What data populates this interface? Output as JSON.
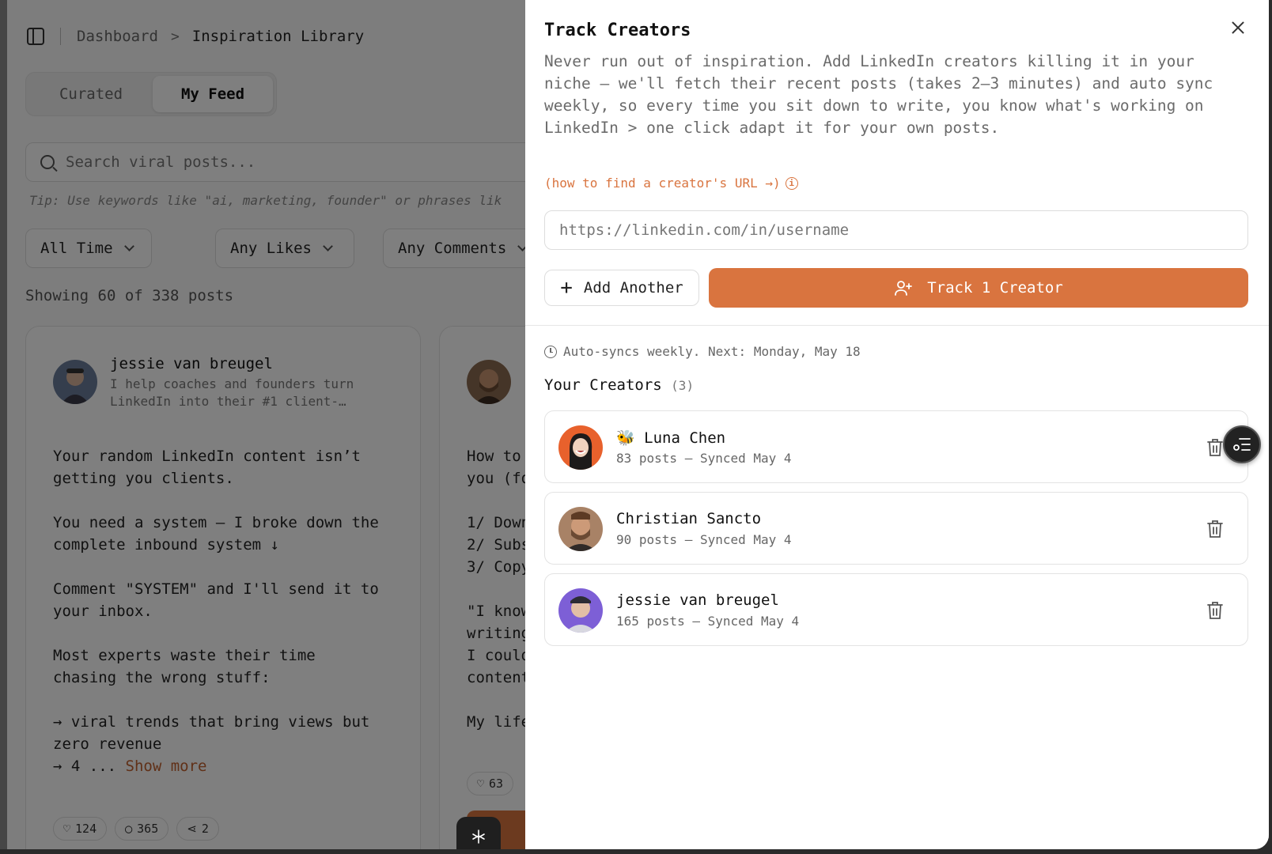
{
  "background": {
    "breadcrumb": {
      "root": "Dashboard",
      "separator": ">",
      "current": "Inspiration Library"
    },
    "tabs": [
      {
        "label": "Curated"
      },
      {
        "label": "My Feed"
      }
    ],
    "search": {
      "placeholder": "Search viral posts..."
    },
    "tip": "Tip: Use keywords like \"ai, marketing, founder\" or phrases lik",
    "filters": [
      {
        "label": "All Time"
      },
      {
        "label": "Any Likes"
      },
      {
        "label": "Any Comments"
      }
    ],
    "showing": "Showing 60 of 338 posts",
    "cards": [
      {
        "author": "jessie van breugel",
        "subtitle": "I help coaches and founders turn LinkedIn into their #1 client-…",
        "body": "Your random LinkedIn content isn’t\ngetting you clients.\n\nYou need a system — I broke down the\ncomplete inbound system ↓\n\nComment \"SYSTEM\" and I'll send it to\nyour inbox.\n\nMost experts waste their time\nchasing the wrong stuff:\n\n→ viral trends that bring views but\nzero revenue\n→ 4 ...",
        "show_more": "Show more",
        "likes": "124",
        "comments": "365",
        "shares": "2"
      },
      {
        "body": "How to\nyou (fo\n\n1/ Down\n2/ Subs\n3/ Copy\n\n\"I know\nwriting\nI could\ncontent\n\nMy life",
        "likes": "63"
      }
    ]
  },
  "drawer": {
    "title": "Track Creators",
    "description": "Never run out of inspiration. Add LinkedIn creators killing it in your niche — we'll fetch their recent posts (takes 2–3 minutes) and auto sync weekly, so every time you sit down to write, you know what's working on LinkedIn > one click adapt it for your own posts.",
    "howto_link": "(how to find a creator's URL →)",
    "url_placeholder": "https://linkedin.com/in/username",
    "add_another": "Add Another",
    "track_button": "Track 1 Creator",
    "sync_text": "Auto-syncs weekly. Next: Monday, May 18",
    "your_creators": "Your Creators",
    "creator_count": "(3)",
    "creators": [
      {
        "emoji": "🐝",
        "name": "Luna Chen",
        "meta": "83 posts — Synced May 4"
      },
      {
        "name": "Christian Sancto",
        "meta": "90 posts — Synced May 4"
      },
      {
        "name": "jessie van breugel",
        "meta": "165 posts — Synced May 4"
      }
    ]
  },
  "colors": {
    "accent": "#d9743f",
    "overlay": "rgba(0,0,0,0.5)"
  }
}
